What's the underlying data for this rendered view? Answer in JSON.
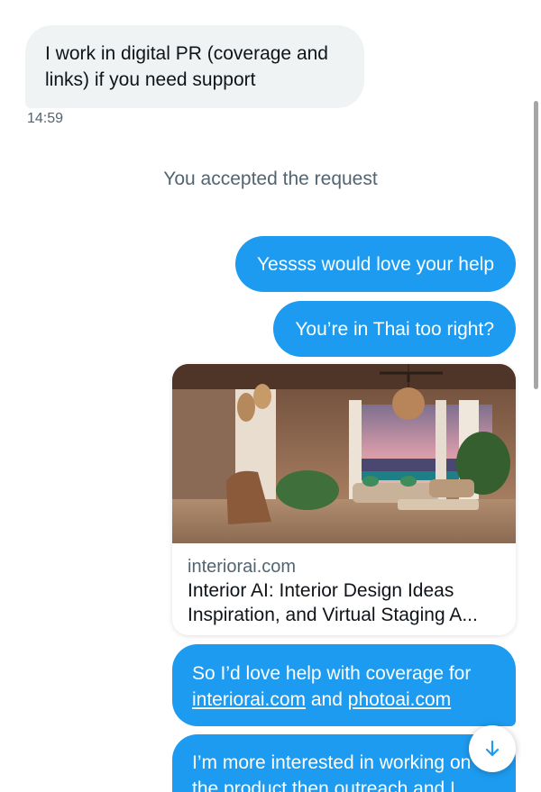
{
  "messages": {
    "incoming_1": {
      "text_line1": "I work in digital PR (coverage and",
      "text_line2": "links) if you need support",
      "time": "14:59"
    },
    "system": {
      "text": "You accepted the request"
    },
    "outgoing_1": {
      "text": "Yessss would love your help"
    },
    "outgoing_2": {
      "text": "You’re in Thai too right?"
    },
    "link_card": {
      "domain": "interiorai.com",
      "title_line1": "Interior AI: Interior Design Ideas",
      "title_line2": "Inspiration, and Virtual Staging A..."
    },
    "outgoing_3": {
      "line1": "So I’d love help with coverage for",
      "link1": "interiorai.com",
      "and": " and ",
      "link2": "photoai.com"
    },
    "outgoing_4": {
      "line1": "I’m more interested in working on",
      "line2": "the product then outreach and I"
    }
  },
  "controls": {
    "scroll_down_icon": "arrow-down-icon"
  },
  "colors": {
    "accent": "#1d9bf0",
    "incoming_bg": "#eff3f4",
    "muted_text": "#536471"
  }
}
